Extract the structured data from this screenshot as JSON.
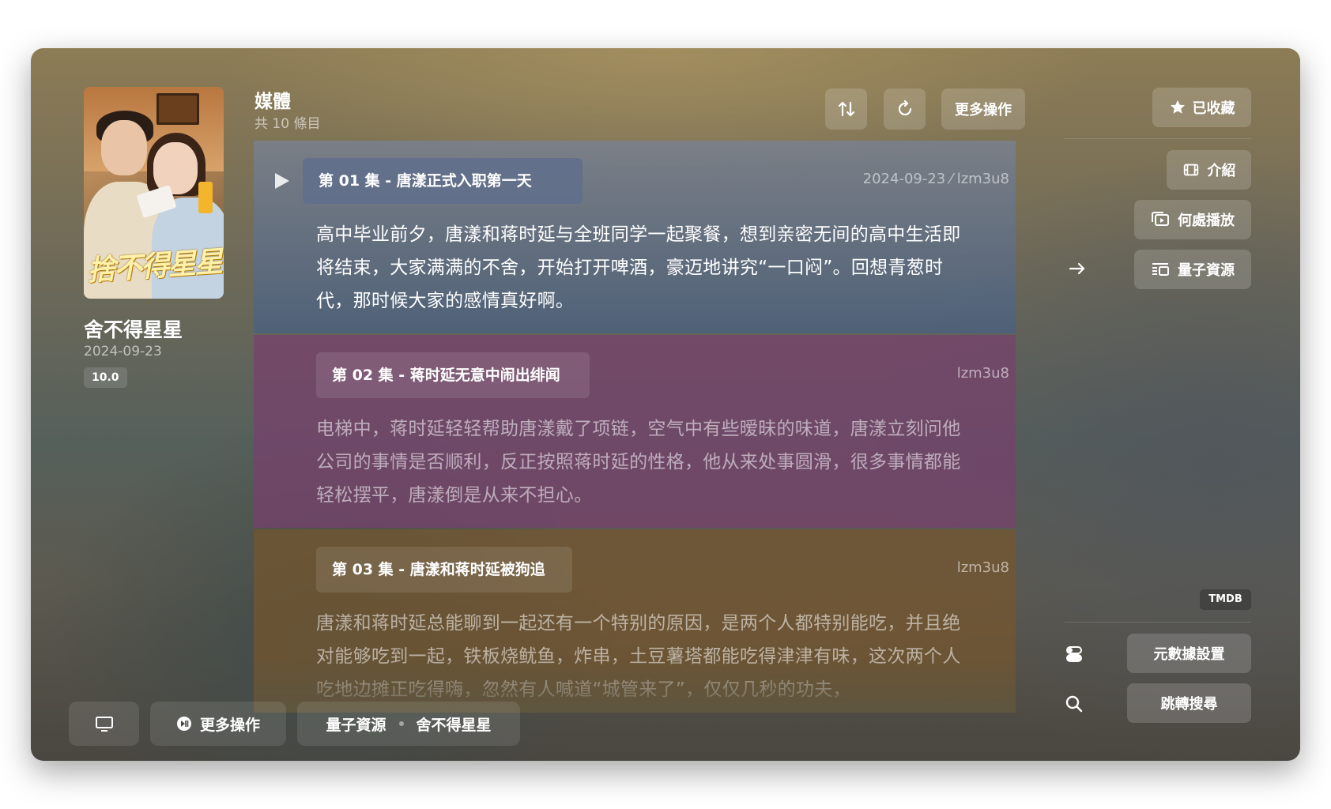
{
  "show": {
    "poster_title": "捨不得星星",
    "title": "舍不得星星",
    "date": "2024-09-23",
    "rating": "10.0"
  },
  "header": {
    "title": "媒體",
    "count": "共 10 條目",
    "sort_icon": "sort-arrows-icon",
    "refresh_icon": "refresh-icon",
    "more_label": "更多操作"
  },
  "episodes": [
    {
      "title": "第 01 集 - 唐漾正式入职第一天",
      "meta": "2024-09-23 ⁄ lzm3u8",
      "description": "高中毕业前夕，唐漾和蒋时延与全班同学一起聚餐，想到亲密无间的高中生活即将结束，大家满满的不舍，开始打开啤酒，豪迈地讲究“一口闷”。回想青葱时代，那时候大家的感情真好啊。"
    },
    {
      "title": "第 02 集 - 蒋时延无意中闹出绯闻",
      "meta": "lzm3u8",
      "description": "电梯中，蒋时延轻轻帮助唐漾戴了项链，空气中有些暧昧的味道，唐漾立刻问他公司的事情是否顺利，反正按照蒋时延的性格，他从来处事圆滑，很多事情都能轻松摆平，唐漾倒是从来不担心。"
    },
    {
      "title": "第 03 集 - 唐漾和蒋时延被狗追",
      "meta": "lzm3u8",
      "description": "唐漾和蒋时延总能聊到一起还有一个特别的原因，是两个人都特别能吃，并且绝对能够吃到一起，铁板烧鱿鱼，炸串，土豆薯塔都能吃得津津有味，这次两个人吃地边摊正吃得嗨，忽然有人喊道“城管来了”，仅仅几秒的功夫，"
    }
  ],
  "right_panel": {
    "favorite_label": "已收藏",
    "intro_label": "介紹",
    "where_label": "何處播放",
    "source_label": "量子資源",
    "provider_badge": "TMDB",
    "metadata_label": "元數據設置",
    "jump_search_label": "跳轉搜尋"
  },
  "bottom_bar": {
    "screen_icon": "monitor-icon",
    "more_label": "更多操作",
    "breadcrumb_source": "量子資源",
    "breadcrumb_title": "舍不得星星"
  }
}
